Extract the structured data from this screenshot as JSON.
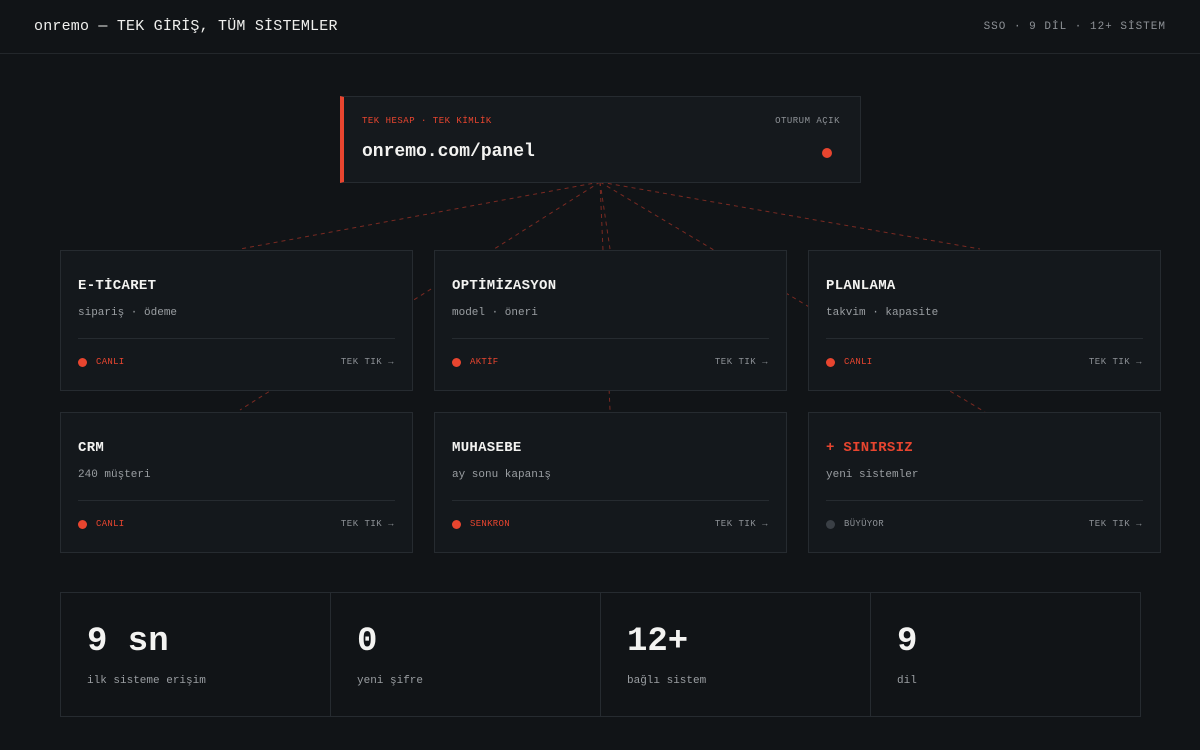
{
  "header": {
    "brand": "onremo — TEK GİRİŞ, TÜM SİSTEMLER",
    "meta": "SSO · 9 DİL · 12+ SİSTEM"
  },
  "panel": {
    "tag": "TEK HESAP · TEK KİMLİK",
    "status": "OTURUM AÇIK",
    "url": "onremo.com/panel"
  },
  "cards": [
    {
      "title": "E-TİCARET",
      "sub": "sipariş · ödeme",
      "status": "CANLI",
      "cta": "TEK TIK →"
    },
    {
      "title": "OPTİMİZASYON",
      "sub": "model · öneri",
      "status": "AKTİF",
      "cta": "TEK TIK →"
    },
    {
      "title": "PLANLAMA",
      "sub": "takvim · kapasite",
      "status": "CANLI",
      "cta": "TEK TIK →"
    },
    {
      "title": "CRM",
      "sub": "240 müşteri",
      "status": "CANLI",
      "cta": "TEK TIK →"
    },
    {
      "title": "MUHASEBE",
      "sub": "ay sonu kapanış",
      "status": "SENKRON",
      "cta": "TEK TIK →"
    },
    {
      "title": "+ SINIRSIZ",
      "sub": "yeni sistemler",
      "status": "BÜYÜYOR",
      "cta": "TEK TIK →"
    }
  ],
  "stats": [
    {
      "value": "9 sn",
      "label": "ilk sisteme erişim"
    },
    {
      "value": "0",
      "label": "yeni şifre"
    },
    {
      "value": "12+",
      "label": "bağlı sistem"
    },
    {
      "value": "9",
      "label": "dil"
    }
  ],
  "colors": {
    "accent": "#e8452f",
    "background": "#111417",
    "muted_dot": "#3a3f45"
  }
}
